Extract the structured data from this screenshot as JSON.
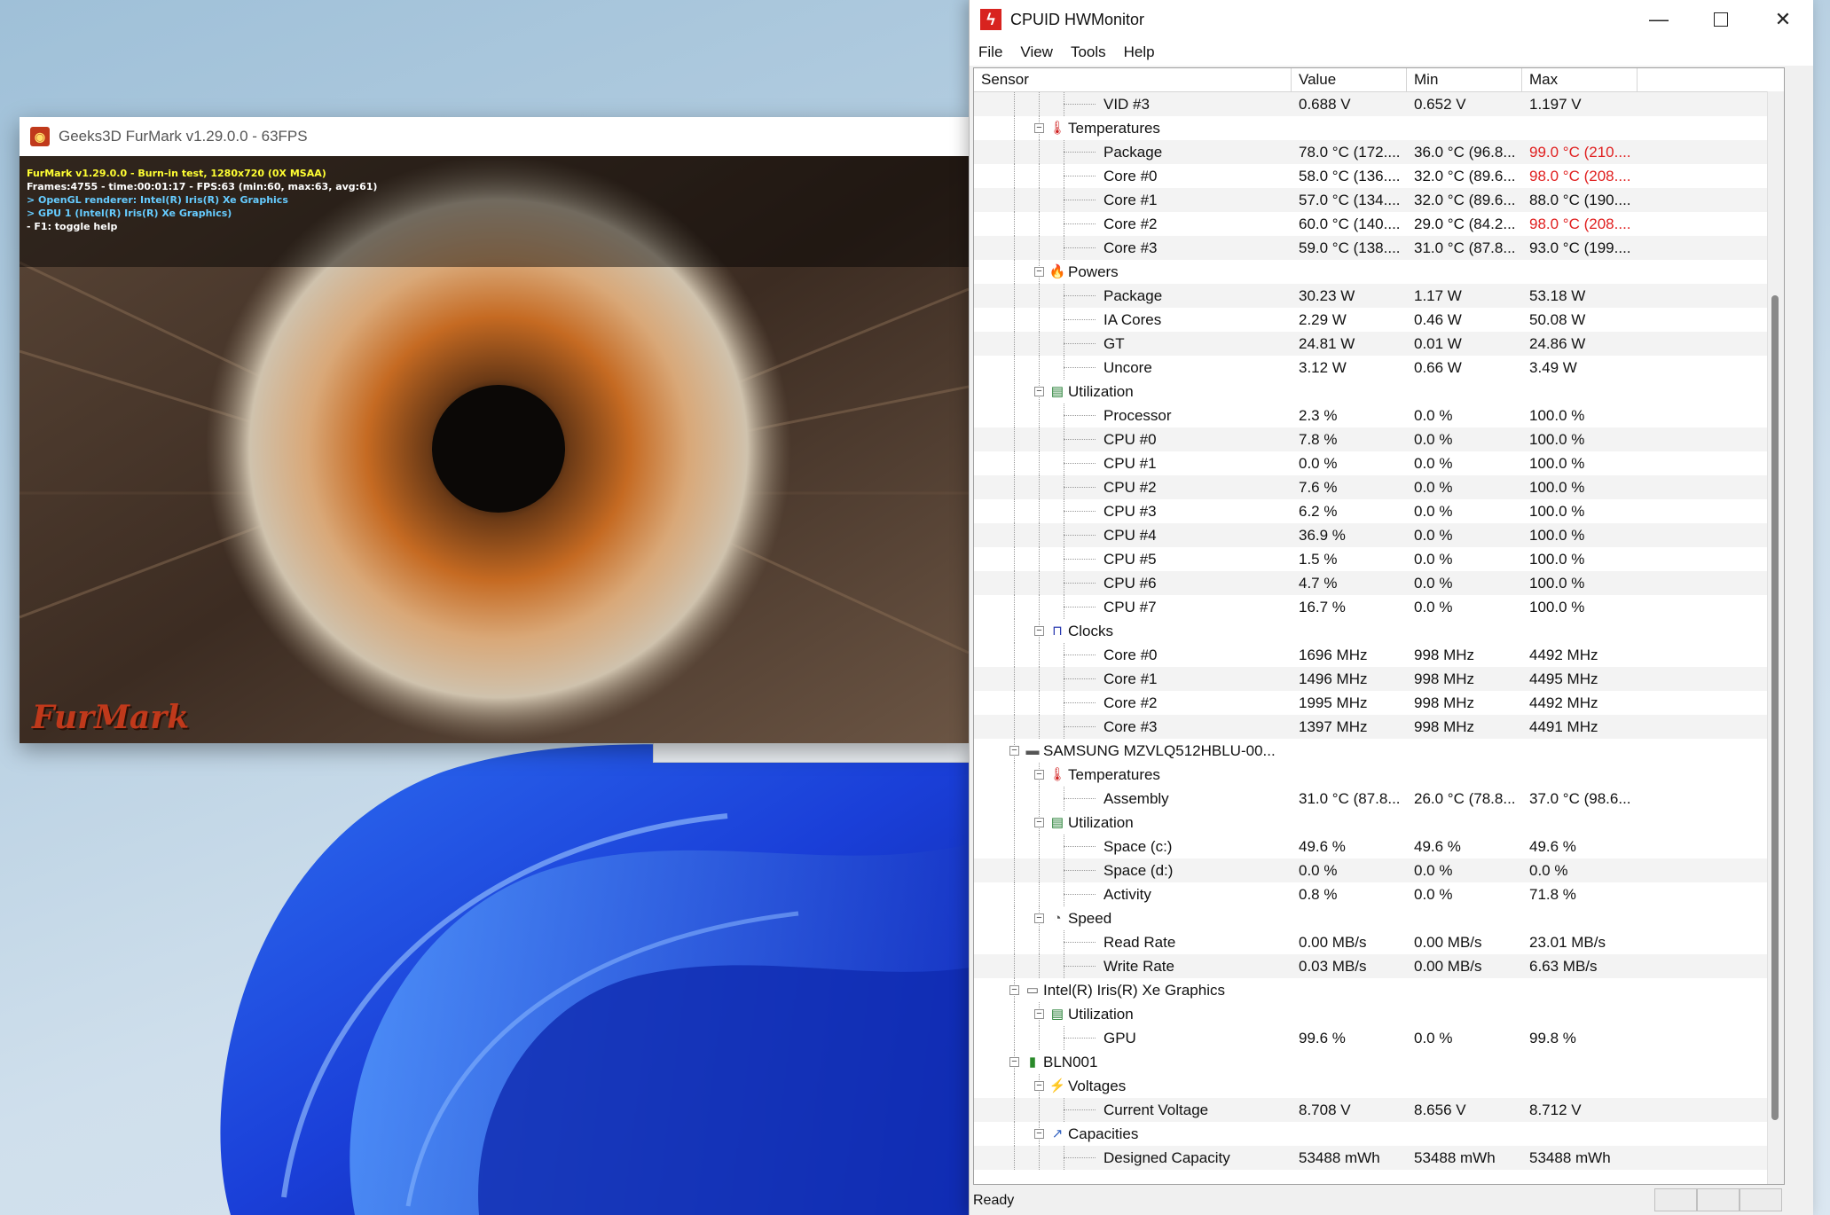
{
  "furmark": {
    "title": "Geeks3D FurMark v1.29.0.0 - 63FPS",
    "hud": [
      {
        "text": "FurMark v1.29.0.0 - Burn-in test, 1280x720 (0X MSAA)",
        "color": "yellow"
      },
      {
        "text": "Frames:4755 - time:00:01:17 - FPS:63 (min:60, max:63, avg:61)",
        "color": "white"
      },
      {
        "text": "> OpenGL renderer: Intel(R) Iris(R) Xe Graphics",
        "color": "cyan"
      },
      {
        "text": "> GPU 1 (Intel(R) Iris(R) Xe Graphics)",
        "color": "cyan"
      },
      {
        "text": "- F1: toggle help",
        "color": "white"
      }
    ],
    "brand": "FurMark"
  },
  "hwmonitor": {
    "title": "CPUID HWMonitor",
    "menu": [
      "File",
      "View",
      "Tools",
      "Help"
    ],
    "columns": [
      "Sensor",
      "Value",
      "Min",
      "Max"
    ],
    "status": "Ready",
    "rows": [
      {
        "level": 3,
        "name": "VID #3",
        "value": "0.688 V",
        "min": "0.652 V",
        "max": "1.197 V"
      },
      {
        "level": 2,
        "name": "Temperatures",
        "icon": "thermometer-icon",
        "glyph": "🌡"
      },
      {
        "level": 3,
        "name": "Package",
        "value": "78.0 °C  (172....",
        "min": "36.0 °C  (96.8...",
        "max": "99.0 °C  (210....",
        "hot": true
      },
      {
        "level": 3,
        "name": "Core #0",
        "value": "58.0 °C  (136....",
        "min": "32.0 °C  (89.6...",
        "max": "98.0 °C  (208....",
        "hot": true
      },
      {
        "level": 3,
        "name": "Core #1",
        "value": "57.0 °C  (134....",
        "min": "32.0 °C  (89.6...",
        "max": "88.0 °C  (190...."
      },
      {
        "level": 3,
        "name": "Core #2",
        "value": "60.0 °C  (140....",
        "min": "29.0 °C  (84.2...",
        "max": "98.0 °C  (208....",
        "hot": true
      },
      {
        "level": 3,
        "name": "Core #3",
        "value": "59.0 °C  (138....",
        "min": "31.0 °C  (87.8...",
        "max": "93.0 °C  (199...."
      },
      {
        "level": 2,
        "name": "Powers",
        "icon": "flame-icon",
        "glyph": "🔥"
      },
      {
        "level": 3,
        "name": "Package",
        "value": "30.23 W",
        "min": "1.17 W",
        "max": "53.18 W"
      },
      {
        "level": 3,
        "name": "IA Cores",
        "value": "2.29 W",
        "min": "0.46 W",
        "max": "50.08 W"
      },
      {
        "level": 3,
        "name": "GT",
        "value": "24.81 W",
        "min": "0.01 W",
        "max": "24.86 W"
      },
      {
        "level": 3,
        "name": "Uncore",
        "value": "3.12 W",
        "min": "0.66 W",
        "max": "3.49 W"
      },
      {
        "level": 2,
        "name": "Utilization",
        "icon": "utilization-icon",
        "glyph": "▤"
      },
      {
        "level": 3,
        "name": "Processor",
        "value": "2.3 %",
        "min": "0.0 %",
        "max": "100.0 %"
      },
      {
        "level": 3,
        "name": "CPU #0",
        "value": "7.8 %",
        "min": "0.0 %",
        "max": "100.0 %"
      },
      {
        "level": 3,
        "name": "CPU #1",
        "value": "0.0 %",
        "min": "0.0 %",
        "max": "100.0 %"
      },
      {
        "level": 3,
        "name": "CPU #2",
        "value": "7.6 %",
        "min": "0.0 %",
        "max": "100.0 %"
      },
      {
        "level": 3,
        "name": "CPU #3",
        "value": "6.2 %",
        "min": "0.0 %",
        "max": "100.0 %"
      },
      {
        "level": 3,
        "name": "CPU #4",
        "value": "36.9 %",
        "min": "0.0 %",
        "max": "100.0 %"
      },
      {
        "level": 3,
        "name": "CPU #5",
        "value": "1.5 %",
        "min": "0.0 %",
        "max": "100.0 %"
      },
      {
        "level": 3,
        "name": "CPU #6",
        "value": "4.7 %",
        "min": "0.0 %",
        "max": "100.0 %"
      },
      {
        "level": 3,
        "name": "CPU #7",
        "value": "16.7 %",
        "min": "0.0 %",
        "max": "100.0 %"
      },
      {
        "level": 2,
        "name": "Clocks",
        "icon": "clock-wave-icon",
        "glyph": "⊓"
      },
      {
        "level": 3,
        "name": "Core #0",
        "value": "1696 MHz",
        "min": "998 MHz",
        "max": "4492 MHz"
      },
      {
        "level": 3,
        "name": "Core #1",
        "value": "1496 MHz",
        "min": "998 MHz",
        "max": "4495 MHz"
      },
      {
        "level": 3,
        "name": "Core #2",
        "value": "1995 MHz",
        "min": "998 MHz",
        "max": "4492 MHz"
      },
      {
        "level": 3,
        "name": "Core #3",
        "value": "1397 MHz",
        "min": "998 MHz",
        "max": "4491 MHz"
      },
      {
        "level": 1,
        "name": "SAMSUNG MZVLQ512HBLU-00...",
        "icon": "drive-icon",
        "glyph": "▬"
      },
      {
        "level": 2,
        "name": "Temperatures",
        "icon": "thermometer-icon",
        "glyph": "🌡"
      },
      {
        "level": 3,
        "name": "Assembly",
        "value": "31.0 °C  (87.8...",
        "min": "26.0 °C  (78.8...",
        "max": "37.0 °C  (98.6..."
      },
      {
        "level": 2,
        "name": "Utilization",
        "icon": "utilization-icon",
        "glyph": "▤"
      },
      {
        "level": 3,
        "name": "Space (c:)",
        "value": "49.6 %",
        "min": "49.6 %",
        "max": "49.6 %"
      },
      {
        "level": 3,
        "name": "Space (d:)",
        "value": "0.0 %",
        "min": "0.0 %",
        "max": "0.0 %"
      },
      {
        "level": 3,
        "name": "Activity",
        "value": "0.8 %",
        "min": "0.0 %",
        "max": "71.8 %"
      },
      {
        "level": 2,
        "name": "Speed",
        "icon": "speedometer-icon",
        "glyph": "◔"
      },
      {
        "level": 3,
        "name": "Read Rate",
        "value": "0.00 MB/s",
        "min": "0.00 MB/s",
        "max": "23.01 MB/s"
      },
      {
        "level": 3,
        "name": "Write Rate",
        "value": "0.03 MB/s",
        "min": "0.00 MB/s",
        "max": "6.63 MB/s"
      },
      {
        "level": 1,
        "name": "Intel(R) Iris(R) Xe Graphics",
        "icon": "gpu-icon",
        "glyph": "▭"
      },
      {
        "level": 2,
        "name": "Utilization",
        "icon": "utilization-icon",
        "glyph": "▤"
      },
      {
        "level": 3,
        "name": "GPU",
        "value": "99.6 %",
        "min": "0.0 %",
        "max": "99.8 %"
      },
      {
        "level": 1,
        "name": "BLN001",
        "icon": "battery-icon",
        "glyph": "▮"
      },
      {
        "level": 2,
        "name": "Voltages",
        "icon": "voltage-icon",
        "glyph": "⚡"
      },
      {
        "level": 3,
        "name": "Current Voltage",
        "value": "8.708 V",
        "min": "8.656 V",
        "max": "8.712 V"
      },
      {
        "level": 2,
        "name": "Capacities",
        "icon": "capacity-icon",
        "glyph": "↗"
      },
      {
        "level": 3,
        "name": "Designed Capacity",
        "value": "53488 mWh",
        "min": "53488 mWh",
        "max": "53488 mWh"
      }
    ]
  },
  "colors": {
    "hot": "#e02020",
    "hud_yellow": "#ffff33",
    "hud_cyan": "#66ccff",
    "alt_row": "#f3f3f3"
  }
}
